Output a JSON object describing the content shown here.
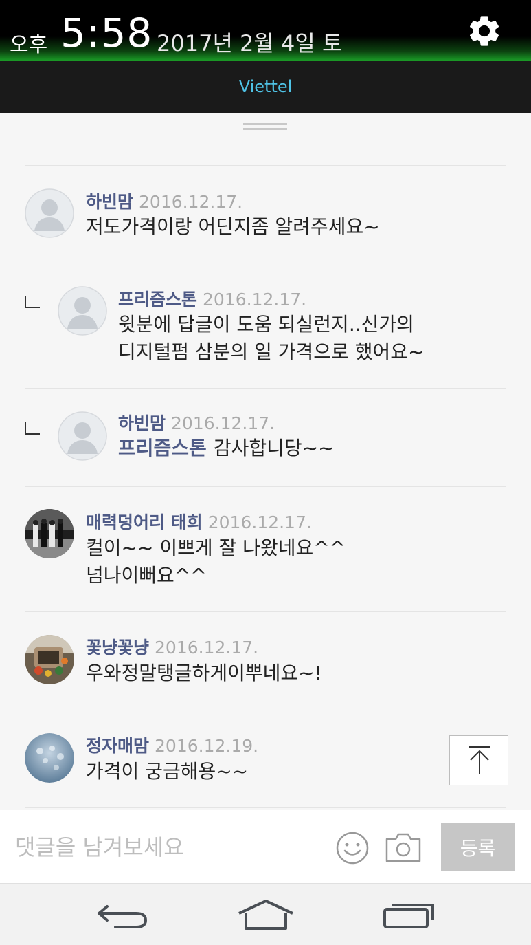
{
  "status_bar": {
    "ampm": "오후",
    "time": "5:58",
    "date": "2017년 2월 4일 토"
  },
  "notification": {
    "carrier": "Viettel"
  },
  "comments": [
    {
      "author": "하빈맘",
      "date": "2016.12.17.",
      "lines": [
        "저도가격이랑 어딘지좀 알려주세요~"
      ]
    },
    {
      "author": "프리즘스톤",
      "date": "2016.12.17.",
      "reply": true,
      "lines": [
        "윗분에 답글이 도움 되실런지..신가의",
        "디지털펌 삼분의 일 가격으로 했어요~"
      ]
    },
    {
      "author": "하빈맘",
      "date": "2016.12.17.",
      "reply": true,
      "mention": "프리즘스톤",
      "lines": [
        "감사합니당~~"
      ]
    },
    {
      "author": "매력덩어리 태희",
      "date": "2016.12.17.",
      "lines": [
        "컬이~~ 이쁘게 잘 나왔네요^^",
        "넘나이뻐요^^"
      ]
    },
    {
      "author": "꽃냥꽃냥",
      "date": "2016.12.17.",
      "lines": [
        "우와정말탱글하게이뿌네요~!"
      ]
    },
    {
      "author": "정자매맘",
      "date": "2016.12.19.",
      "lines": [
        "가격이 궁금해용~~"
      ]
    }
  ],
  "input": {
    "placeholder": "댓글을 남겨보세요",
    "submit_label": "등록"
  },
  "icons": {
    "settings": "gear-icon",
    "emoji": "smiley-icon",
    "camera": "camera-icon",
    "scroll_top": "arrow-up-to-top-icon",
    "back": "back-icon",
    "home": "home-icon",
    "recent": "recent-apps-icon"
  },
  "colors": {
    "author": "#4e5a86",
    "date": "#aaaaaa",
    "carrier": "#4fc3e6",
    "submit_bg": "#c6c6c6"
  }
}
